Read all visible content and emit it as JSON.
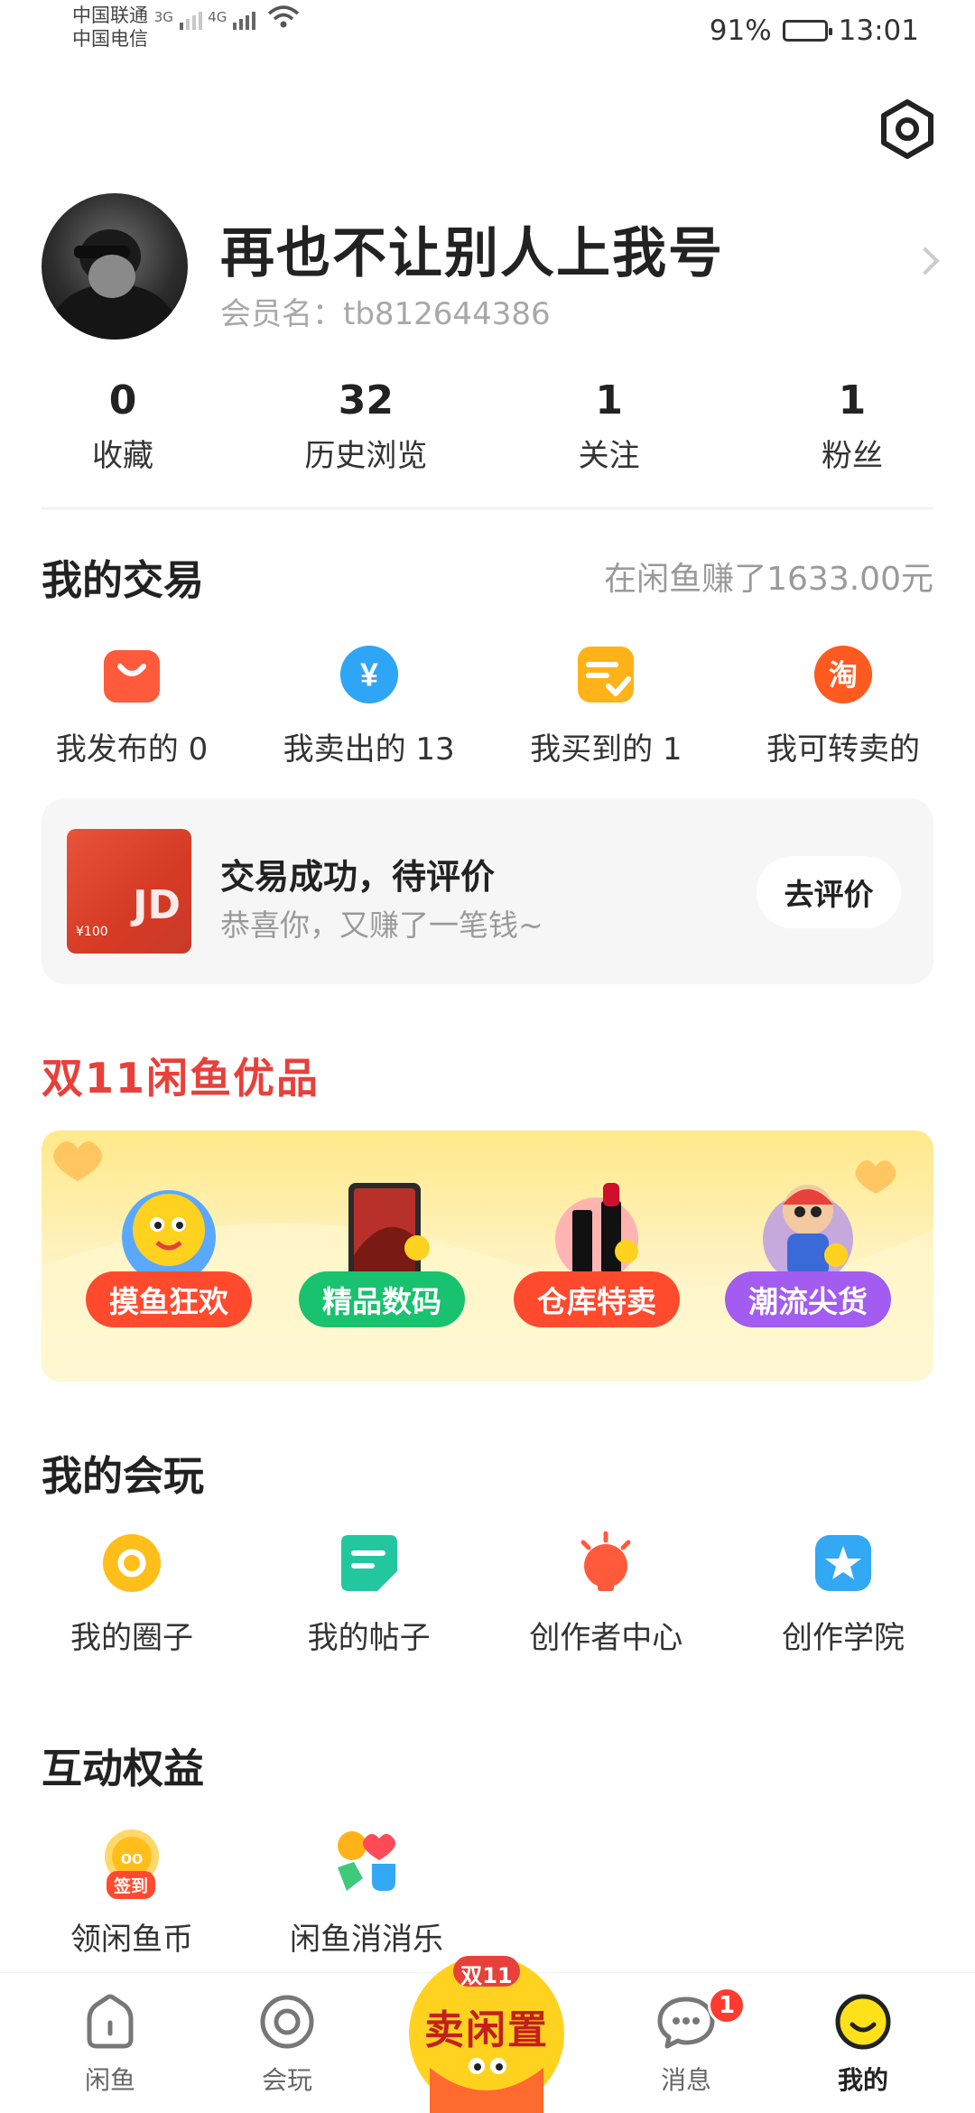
{
  "status_bar": {
    "carrier_1": "中国联通",
    "carrier_2": "中国电信",
    "net_1": "3G",
    "net_2": "4G",
    "battery": "91%",
    "time": "13:01"
  },
  "profile": {
    "nickname": "再也不让别人上我号",
    "member_label": "会员名：",
    "member_id": "tb812644386"
  },
  "stats": [
    {
      "num": "0",
      "label": "收藏"
    },
    {
      "num": "32",
      "label": "历史浏览"
    },
    {
      "num": "1",
      "label": "关注"
    },
    {
      "num": "1",
      "label": "粉丝"
    }
  ],
  "trade": {
    "title": "我的交易",
    "earned": "在闲鱼赚了1633.00元",
    "items": [
      {
        "label": "我发布的 0",
        "icon": "bag-icon",
        "color": "#ff5a3c"
      },
      {
        "label": "我卖出的 13",
        "icon": "yen-icon",
        "color": "#2ea6f5"
      },
      {
        "label": "我买到的 1",
        "icon": "checklist-icon",
        "color": "#ffb319"
      },
      {
        "label": "我可转卖的",
        "icon": "taobao-icon",
        "color": "#ff5a1f"
      }
    ],
    "card": {
      "title": "交易成功，待评价",
      "subtitle": "恭喜你，又赚了一笔钱~",
      "button": "去评价",
      "image_text": "JD",
      "image_small": "¥100"
    }
  },
  "promo": {
    "title": "双11闲鱼优品",
    "items": [
      {
        "label": "摸鱼狂欢",
        "color": "#ff4a2e"
      },
      {
        "label": "精品数码",
        "color": "#18c26e"
      },
      {
        "label": "仓库特卖",
        "color": "#ff4a2e"
      },
      {
        "label": "潮流尖货",
        "color": "#a25cf0"
      }
    ]
  },
  "play": {
    "title": "我的会玩",
    "items": [
      {
        "label": "我的圈子",
        "icon": "circle-icon",
        "color": "#ffbe1a"
      },
      {
        "label": "我的帖子",
        "icon": "post-icon",
        "color": "#22c7a0"
      },
      {
        "label": "创作者中心",
        "icon": "bulb-icon",
        "color": "#ff5a3c"
      },
      {
        "label": "创作学院",
        "icon": "star-icon",
        "color": "#33a8f5"
      }
    ]
  },
  "benefits": {
    "title": "互动权益",
    "items": [
      {
        "label": "领闲鱼币",
        "icon": "checkin-icon",
        "badge": "签到"
      },
      {
        "label": "闲鱼消消乐",
        "icon": "game-icon"
      }
    ]
  },
  "tabbar": {
    "tabs": [
      {
        "label": "闲鱼"
      },
      {
        "label": "会玩"
      },
      {
        "label": "消息"
      },
      {
        "label": "我的"
      }
    ],
    "fab_top": "双11",
    "fab_main": "卖闲置",
    "message_badge": "1"
  }
}
